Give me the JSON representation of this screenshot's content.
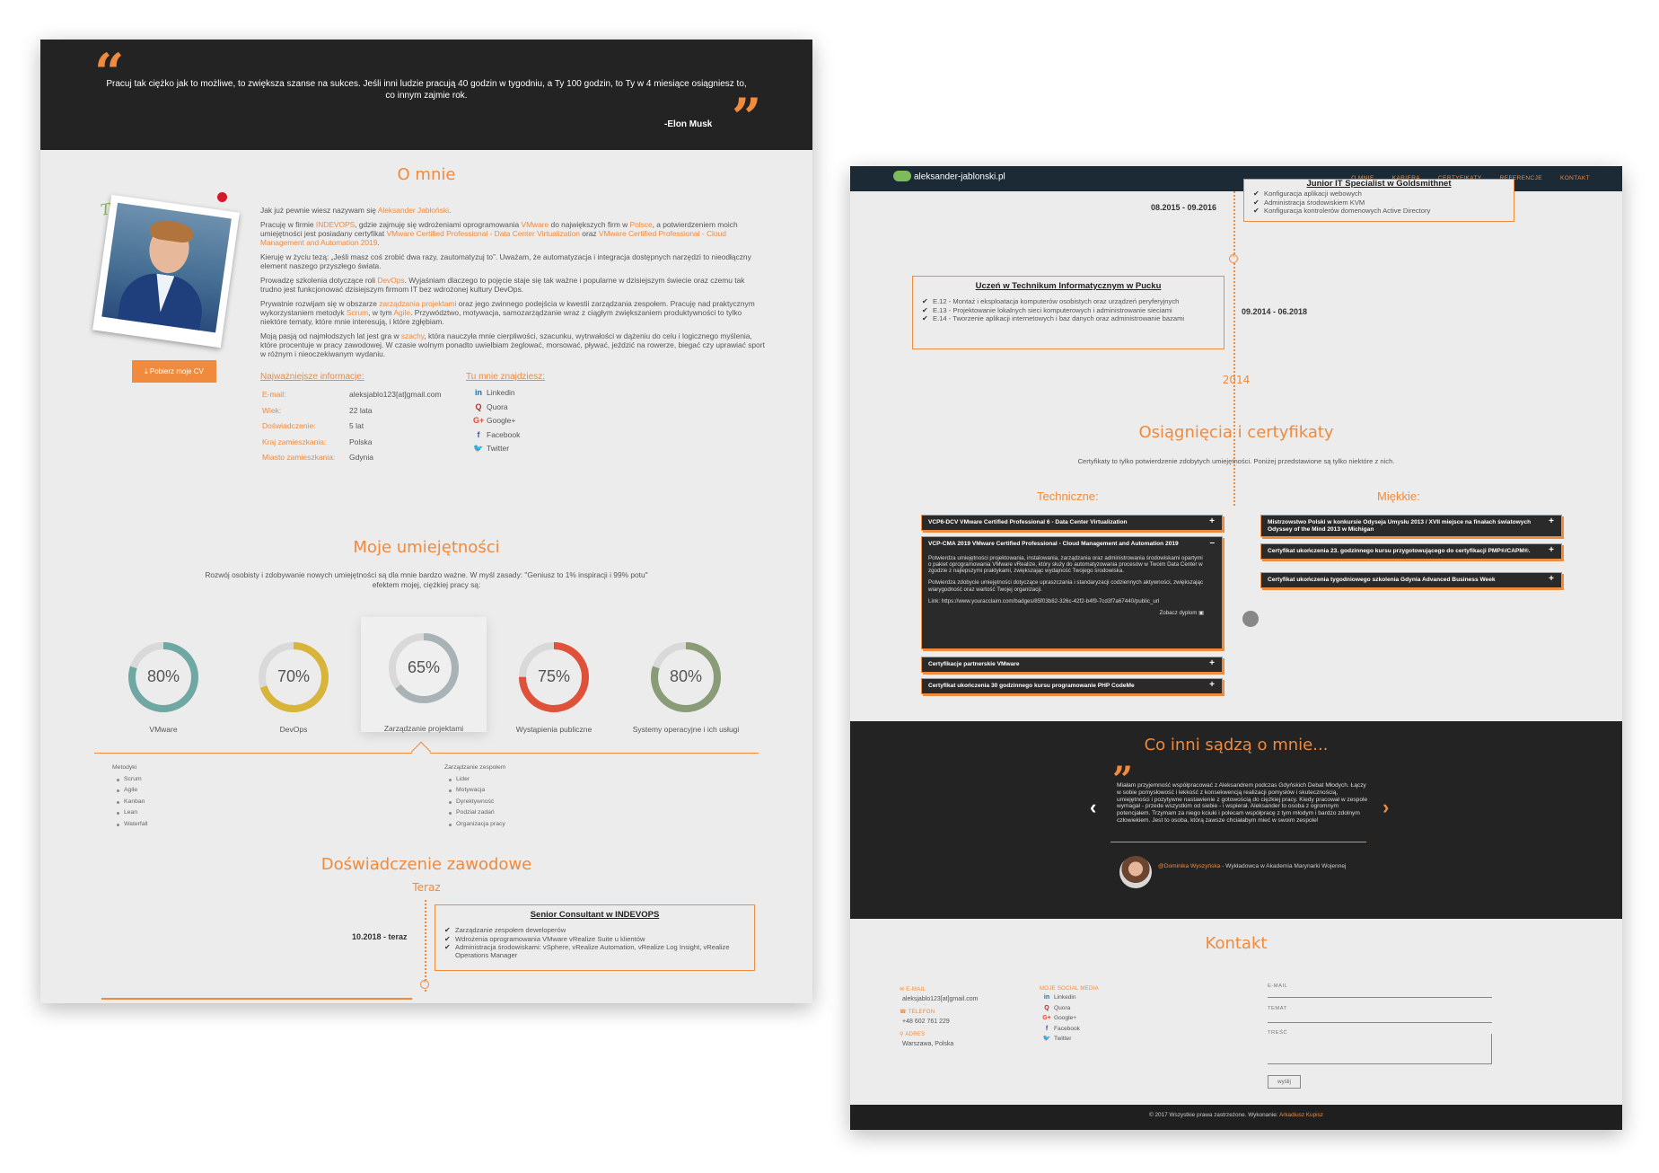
{
  "left": {
    "quote": {
      "text": "Pracuj tak ciężko jak to możliwe, to zwiększa szanse na sukces. Jeśli inni ludzie pracują 40 godzin w tygodniu, a Ty 100 godzin, to Ty w 4 miesiące osiągniesz to, co innym zajmie rok.",
      "author": "-Elon Musk"
    },
    "about": {
      "title": "O mnie",
      "photo_caption": "To ja",
      "cv_button": "Pobierz moje CV",
      "p1_a": "Jak już pewnie wiesz nazywam się ",
      "p1_name": "Aleksander Jabłoński",
      "p1_b": ".",
      "p2_a": "Pracuję w firmie ",
      "p2_company": "INDEVOPS",
      "p2_b": ", gdzie zajmuję się wdrożeniami oprogramowania ",
      "p2_vmware": "VMware",
      "p2_c": " do największych firm w ",
      "p2_polska": "Polsce",
      "p2_d": ", a potwierdzeniem moich umiejętności jest posiadany certyfikat ",
      "p2_cert1": "VMware Certified Professional - Data Center Virtualization",
      "p2_e": " oraz ",
      "p2_cert2": "VMware Certified Professional - Cloud Management and Automation 2019",
      "p2_f": ".",
      "p3": "Kieruję w życiu tezą: „Jeśli masz coś zrobić dwa razy, zautomatyzuj to”. Uważam, że automatyzacja i integracja dostępnych narzędzi to nieodłączny element naszego przyszłego świata.",
      "p4_a": "Prowadzę szkolenia dotyczące roli ",
      "p4_devops": "DevOps",
      "p4_b": ". Wyjaśniam dlaczego to pojęcie staje się tak ważne i popularne w dzisiejszym świecie oraz czemu tak trudno jest funkcjonować dzisiejszym firmom IT bez wdrożonej kultury DevOps.",
      "p5_a": "Prywatnie rozwijam się w obszarze ",
      "p5_pm": "zarządzania projektami",
      "p5_b": " oraz jego zwinnego podejścia w kwestii zarządzania zespołem. Pracuję nad praktycznym wykorzystaniem metodyk ",
      "p5_scrum": "Scrum",
      "p5_c": ", w tym ",
      "p5_agile": "Agile",
      "p5_d": ". Przywództwo, motywacja, samozarządzanie wraz z ciągłym zwiększaniem produktywności to tylko niektóre tematy, które mnie interesują, i które zgłębiam.",
      "p6_a": "Moją pasją od najmłodszych lat jest gra w ",
      "p6_chess": "szachy",
      "p6_b": ", która nauczyła mnie cierpliwości, szacunku, wytrwałości w dążeniu do celu i logicznego myślenia, które procentuje w pracy zawodowej. W czasie wolnym ponadto uwielbiam żeglować, morsować, pływać, jeździć na rowerze, biegać czy uprawiać sport w różnym i nieoczekiwanym wydaniu."
    },
    "info": {
      "title": "Najważniejsze informacje:",
      "rows": [
        {
          "k": "E-mail:",
          "v": "aleksjablo123[at]gmail.com"
        },
        {
          "k": "Wiek:",
          "v": "22 lata"
        },
        {
          "k": "Doświadczenie:",
          "v": "5 lat"
        },
        {
          "k": "Kraj zamieszkania:",
          "v": "Polska"
        },
        {
          "k": "Miasto zamieszkania:",
          "v": "Gdynia"
        }
      ]
    },
    "find": {
      "title": "Tu mnie znajdziesz:",
      "items": [
        "Linkedin",
        "Quora",
        "Google+",
        "Facebook",
        "Twitter"
      ]
    },
    "skills": {
      "title": "Moje umiejętności",
      "subtitle": "Rozwój osobisty i zdobywanie nowych umiejętności są dla mnie bardzo ważne. W myśl zasady: \"Geniusz to 1% inspiracji i 99% potu\" efektem mojej, ciężkiej pracy są:",
      "items": [
        {
          "label": "VMware",
          "pct": 80,
          "text": "80%",
          "color": "#6fa8a3"
        },
        {
          "label": "DevOps",
          "pct": 70,
          "text": "70%",
          "color": "#d9b43a"
        },
        {
          "label": "Zarządzanie projektami",
          "pct": 65,
          "text": "65%",
          "color": "#a9b2b5"
        },
        {
          "label": "Wystąpienia publiczne",
          "pct": 75,
          "text": "75%",
          "color": "#e0513a"
        },
        {
          "label": "Systemy operacyjne i ich usługi",
          "pct": 80,
          "text": "80%",
          "color": "#8a9c77"
        }
      ],
      "methods_title": "Metodyki",
      "methods": [
        "Scrum",
        "Agile",
        "Kanban",
        "Lean",
        "Waterfall"
      ],
      "team_title": "Zarządzanie zespołem",
      "team": [
        "Lider",
        "Motywacja",
        "Dyrektywność",
        "Podział zadań",
        "Organizacja pracy"
      ]
    },
    "experience": {
      "title": "Doświadczenie zawodowe",
      "now": "Teraz",
      "date": "10.2018 - teraz",
      "job_title": "Senior Consultant w INDEVOPS",
      "duties": [
        "Zarządzanie zespołem deweloperów",
        "Wdrożenia oprogramowania VMware vRealize Suite u klientów",
        "Administracja środowiskami: vSphere, vRealize Automation, vRealize Log Insight, vRealize Operations Manager"
      ]
    }
  },
  "right": {
    "nav": {
      "logo": "aleksander-jablonski.pl",
      "links": [
        "O MNIE",
        "KARIERA",
        "CERTYFIKATY",
        "REFERENCJE",
        "KONTAKT"
      ]
    },
    "timeline": {
      "cut_title": "Junior IT Specialist w Goldsmithnet",
      "date1": "08.2015 - 09.2016",
      "duties1": [
        "Konfiguracja aplikacji webowych",
        "Administracja środowiskiem KVM",
        "Konfiguracja kontrolerów domenowych Active Directory"
      ],
      "school_title": "Uczeń w Technikum Informatycznym w Pucku",
      "school_items": [
        "E.12 - Montaż i eksploatacja komputerów osobistych oraz urządzeń peryferyjnych",
        "E.13 - Projektowanie lokalnych sieci komputerowych i administrowanie sieciami",
        "E.14 - Tworzenie aplikacji internetowych i baz danych oraz administrowanie bazami"
      ],
      "date2": "09.2014 - 06.2018",
      "year": "2014"
    },
    "certs": {
      "title": "Osiągnięcia i certyfikaty",
      "subtitle": "Certyfikaty to tylko potwierdzenie zdobytych umiejętności. Poniżej przedstawione są tylko niektóre z nich.",
      "tech_title": "Techniczne:",
      "soft_title": "Miękkie:",
      "tech": [
        "VCP6-DCV VMware Certified Professional 6 - Data Center Virtualization",
        "VCP-CMA 2019 VMware Certified Professional - Cloud Management and Automation 2019",
        "Certyfikacje partnerskie VMware",
        "Certyfikat ukończenia 30 godzinnego kursu programowanie PHP CodeMe"
      ],
      "expanded_p1": "Potwierdza umiejętności projektowania, instalowania, zarządzania oraz administrowania środowiskami opartymi o pakiet oprogramowania VMware vRealize, który służy do automatyzowania procesów w Twoim Data Center w zgodzie z najlepszymi praktykami, zwiększając wydajność Twojego środowiska.",
      "expanded_p2": "Potwierdza zdobycie umiejętności dotyczące upraszczania i standaryzacji codziennych aktywności, zwiększając wiarygodność oraz wartość Twojej organizacji.",
      "expanded_link": "Link: https://www.youracclaim.com/badges/85f03b82-326c-42f2-b4f9-7cd3f7a67440/public_url",
      "expanded_diploma": "Zobacz dyplom",
      "soft": [
        "Mistrzowstwo Polski w konkursie Odyseja Umysłu 2013 / XVII miejsce na finałach światowych Odyssey of the Mind 2013 w Michigan",
        "Certyfikat ukończenia 23. godzinnego kursu przygotowującego do certyfikacji PMP®/CAPM®.",
        "Certyfikat ukończenia tygodniowego szkolenia Gdynia Advanced Business Week"
      ]
    },
    "testimonials": {
      "title": "Co inni sądzą o mnie...",
      "text": "Miałam przyjemność współpracować z Aleksandrem podczas Gdyńskich Debat Młodych. Łączy w sobie pomysłowość i lekkość z konsekwencją realizacji pomysłów i skutecznością, umiejętności i pozytywne nastawienie z gotowością do ciężkiej pracy. Kiedy pracował w zespole wymagał - przede wszystkim od siebie - i wspierał. Aleksander to osoba z ogromnym potencjałem. Trzymam za niego kciuki i polecam współpracę z tym młodym i bardzo zdolnym człowiekiem. Jest to osoba, którą zawsze chciałabym mieć w swoim zespole!",
      "author_name": "@Dominika Wyszyńska",
      "author_role": " - Wykładowca w Akademia Marynarki Wojennej"
    },
    "contact": {
      "title": "Kontakt",
      "email_label": "E-MAIL",
      "email": "aleksjablo123[at]gmail.com",
      "phone_label": "TELEFON",
      "phone": "+48 602 761 229",
      "address_label": "ADRES",
      "address": "Warszawa, Polska",
      "social_label": "MOJE SOCIAL MEDIA",
      "social": [
        "Linkedin",
        "Quora",
        "Google+",
        "Facebook",
        "Twitter"
      ],
      "form_email": "E-MAIL",
      "form_subject": "TEMAT",
      "form_body": "TREŚĆ",
      "send": "wyślij"
    },
    "footer": {
      "text": "© 2017 Wszystkie prawa zastrzeżone. Wykonanie: ",
      "author": "Arkadiusz Kupisz"
    }
  }
}
